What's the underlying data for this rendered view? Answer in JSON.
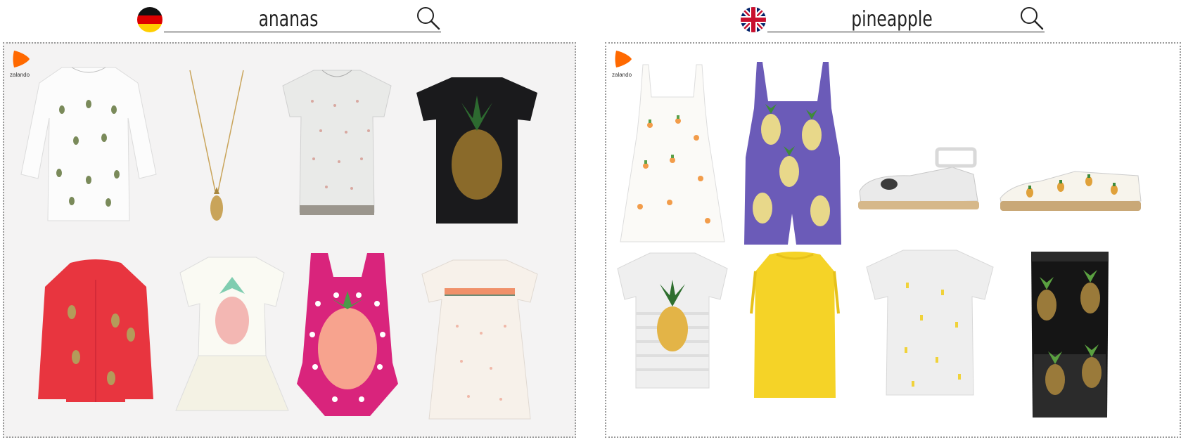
{
  "searches": [
    {
      "id": "de",
      "query": "ananas",
      "flag": "germany-flag-icon"
    },
    {
      "id": "en",
      "query": "pineapple",
      "flag": "uk-flag-icon"
    }
  ],
  "logo": {
    "text": "zalando",
    "color": "#ff6900"
  },
  "colors": {
    "panel_de_bg": "#f4f3f3",
    "panel_en_bg": "#ffffff",
    "border": "#9a9a9a",
    "accent": "#ff6900"
  },
  "products_de": [
    "white-3-4-sleeve-top-with-small-pineapples",
    "gold-pineapple-pendant-necklace",
    "grey-tee-with-pineapple-print",
    "black-tee-with-gold-sequin-pineapple",
    "red-kids-hoodie-with-gold-pineapples",
    "white-tutu-dress-with-pineapple-print",
    "pink-polka-dot-swimsuit-with-pineapple",
    "cream-smocked-top-with-pineapple-print"
  ],
  "products_en": [
    "white-sundress-with-pineapple-print",
    "purple-playsuit-with-pineapple-print",
    "silver-espadrille-sandal-with-pineapple",
    "pineapple-print-espadrille-slip-on",
    "striped-tee-with-sequin-pineapple",
    "yellow-ruffle-sleeveless-top",
    "grey-tee-with-small-yellow-pineapples",
    "black-mesh-skirt-with-pineapple-sequins"
  ]
}
